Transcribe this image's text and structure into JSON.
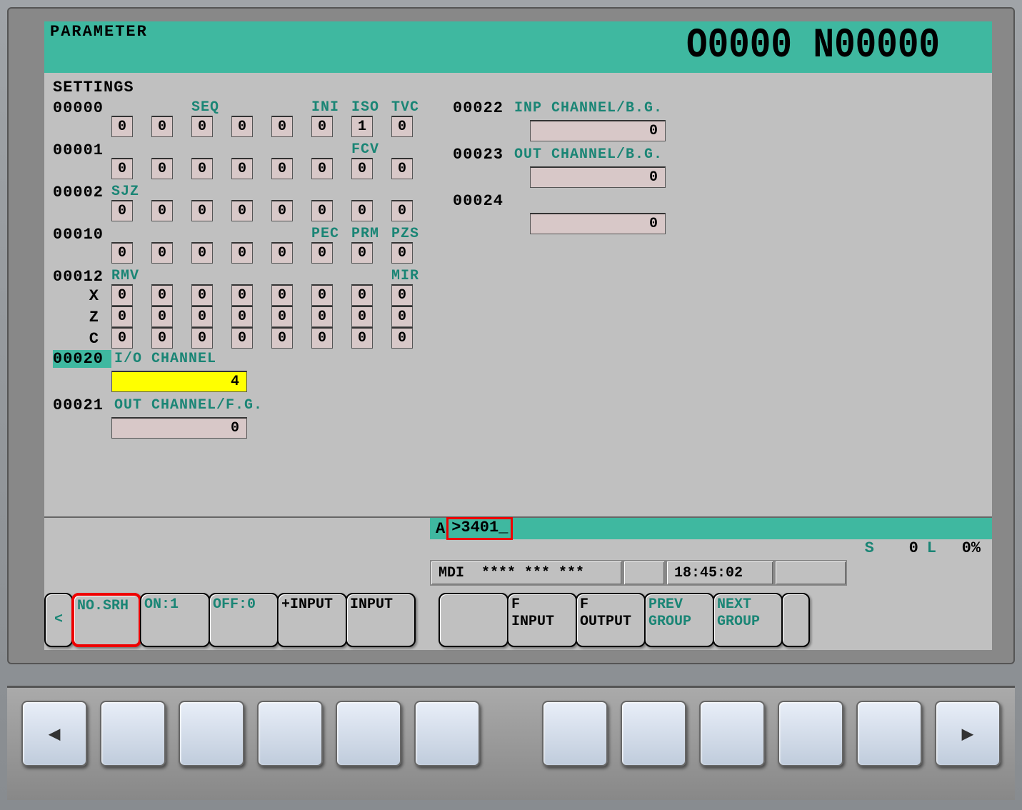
{
  "header": {
    "title": "PARAMETER",
    "program": "O0000 N00000"
  },
  "section_title": "SETTINGS",
  "rows": [
    {
      "num": "00000",
      "labels": [
        "",
        "",
        "SEQ",
        "",
        "",
        "INI",
        "ISO",
        "TVC"
      ],
      "bits": [
        "0",
        "0",
        "0",
        "0",
        "0",
        "0",
        "1",
        "0"
      ]
    },
    {
      "num": "00001",
      "labels": [
        "",
        "",
        "",
        "",
        "",
        "",
        "FCV",
        ""
      ],
      "bits": [
        "0",
        "0",
        "0",
        "0",
        "0",
        "0",
        "0",
        "0"
      ]
    },
    {
      "num": "00002",
      "labels": [
        "SJZ",
        "",
        "",
        "",
        "",
        "",
        "",
        ""
      ],
      "bits": [
        "0",
        "0",
        "0",
        "0",
        "0",
        "0",
        "0",
        "0"
      ]
    },
    {
      "num": "00010",
      "labels": [
        "",
        "",
        "",
        "",
        "",
        "PEC",
        "PRM",
        "PZS"
      ],
      "bits": [
        "0",
        "0",
        "0",
        "0",
        "0",
        "0",
        "0",
        "0"
      ]
    }
  ],
  "row12": {
    "num": "00012",
    "labels": [
      "RMV",
      "",
      "",
      "",
      "",
      "",
      "",
      "MIR"
    ],
    "axes": [
      {
        "name": "X",
        "bits": [
          "0",
          "0",
          "0",
          "0",
          "0",
          "0",
          "0",
          "0"
        ]
      },
      {
        "name": "Z",
        "bits": [
          "0",
          "0",
          "0",
          "0",
          "0",
          "0",
          "0",
          "0"
        ]
      },
      {
        "name": "C",
        "bits": [
          "0",
          "0",
          "0",
          "0",
          "0",
          "0",
          "0",
          "0"
        ]
      }
    ]
  },
  "channels_left": [
    {
      "num": "00020",
      "label": "I/O CHANNEL",
      "value": "4",
      "selected": true,
      "highlight": true
    },
    {
      "num": "00021",
      "label": "OUT CHANNEL/F.G.",
      "value": "0"
    }
  ],
  "channels_right": [
    {
      "num": "00022",
      "label": "INP CHANNEL/B.G.",
      "value": "0"
    },
    {
      "num": "00023",
      "label": "OUT CHANNEL/B.G.",
      "value": "0"
    },
    {
      "num": "00024",
      "label": "",
      "value": "0"
    }
  ],
  "input": {
    "a": "A",
    "gt": ">",
    "value": "3401_"
  },
  "status": {
    "s": "S",
    "sval": "0",
    "l": "L",
    "lval": "0%"
  },
  "mode": {
    "mdi": "MDI  **** *** ***",
    "time": "18:45:02"
  },
  "softkeys_left": [
    {
      "label": "<",
      "teal": true,
      "narrow": true
    },
    {
      "label": "NO.SRH",
      "teal": true,
      "red": true
    },
    {
      "label": "ON:1",
      "teal": true
    },
    {
      "label": "OFF:0",
      "teal": true
    },
    {
      "label": "+INPUT"
    },
    {
      "label": "INPUT"
    }
  ],
  "softkeys_right": [
    {
      "label": ""
    },
    {
      "label": "F\nINPUT"
    },
    {
      "label": "F\nOUTPUT"
    },
    {
      "label": "PREV\nGROUP",
      "teal": true
    },
    {
      "label": "NEXT\nGROUP",
      "teal": true
    },
    {
      "label": "",
      "narrow": true
    }
  ],
  "hw_buttons": [
    "◀",
    "",
    "",
    "",
    "",
    "",
    "",
    "",
    "",
    "",
    "",
    "▶"
  ]
}
